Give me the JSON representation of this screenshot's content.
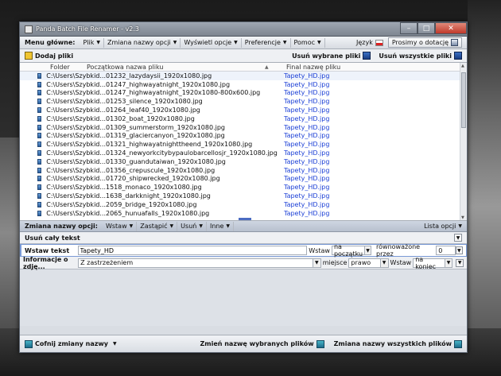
{
  "window": {
    "title": "Panda Batch File Renamer - v2.3"
  },
  "menubar": {
    "label": "Menu główne:",
    "items": [
      "Plik",
      "Zmiana nazwy opcji",
      "Wyświetl opcje",
      "Preferencje",
      "Pomoc"
    ],
    "language": "Język",
    "donate": "Prosimy o dotację"
  },
  "toolbar": {
    "add_files": "Dodaj pliki",
    "remove_selected": "Usuń wybrane pliki",
    "remove_all": "Usuń wszystkie pliki"
  },
  "filelist": {
    "headers": {
      "folder": "Folder",
      "original": "Początkowa nazwa pliku",
      "final": "Final nazwę pliku"
    },
    "rows": [
      {
        "folder": "C:\\Users\\Szybkid...",
        "original": "01232_lazydaysii_1920x1080.jpg",
        "final": "Tapety_HD.jpg"
      },
      {
        "folder": "C:\\Users\\Szybkid...",
        "original": "01247_highwayatnight_1920x1080.jpg",
        "final": "Tapety_HD.jpg"
      },
      {
        "folder": "C:\\Users\\Szybkid...",
        "original": "01247_highwayatnight_1920x1080-800x600.jpg",
        "final": "Tapety_HD.jpg"
      },
      {
        "folder": "C:\\Users\\Szybkid...",
        "original": "01253_silence_1920x1080.jpg",
        "final": "Tapety_HD.jpg"
      },
      {
        "folder": "C:\\Users\\Szybkid...",
        "original": "01264_leaf40_1920x1080.jpg",
        "final": "Tapety_HD.jpg"
      },
      {
        "folder": "C:\\Users\\Szybkid...",
        "original": "01302_boat_1920x1080.jpg",
        "final": "Tapety_HD.jpg"
      },
      {
        "folder": "C:\\Users\\Szybkid...",
        "original": "01309_summerstorm_1920x1080.jpg",
        "final": "Tapety_HD.jpg"
      },
      {
        "folder": "C:\\Users\\Szybkid...",
        "original": "01319_glaciercanyon_1920x1080.jpg",
        "final": "Tapety_HD.jpg"
      },
      {
        "folder": "C:\\Users\\Szybkid...",
        "original": "01321_highwayatnighttheend_1920x1080.jpg",
        "final": "Tapety_HD.jpg"
      },
      {
        "folder": "C:\\Users\\Szybkid...",
        "original": "01324_newyorkcitybypaulobarcellosjr_1920x1080.jpg",
        "final": "Tapety_HD.jpg"
      },
      {
        "folder": "C:\\Users\\Szybkid...",
        "original": "01330_guandutaiwan_1920x1080.jpg",
        "final": "Tapety_HD.jpg"
      },
      {
        "folder": "C:\\Users\\Szybkid...",
        "original": "01356_crepuscule_1920x1080.jpg",
        "final": "Tapety_HD.jpg"
      },
      {
        "folder": "C:\\Users\\Szybkid...",
        "original": "01720_shipwrecked_1920x1080.jpg",
        "final": "Tapety_HD.jpg"
      },
      {
        "folder": "C:\\Users\\Szybkid...",
        "original": "1518_monaco_1920x1080.jpg",
        "final": "Tapety_HD.jpg"
      },
      {
        "folder": "C:\\Users\\Szybkid...",
        "original": "1638_darkknight_1920x1080.jpg",
        "final": "Tapety_HD.jpg"
      },
      {
        "folder": "C:\\Users\\Szybkid...",
        "original": "2059_bridge_1920x1080.jpg",
        "final": "Tapety_HD.jpg"
      },
      {
        "folder": "C:\\Users\\Szybkid...",
        "original": "2065_hunuafalls_1920x1080.jpg",
        "final": "Tapety_HD.jpg"
      }
    ]
  },
  "rename_bar": {
    "label": "Zmiana nazwy opcji:",
    "items": [
      "Wstaw",
      "Zastąpić",
      "Usuń",
      "Inne"
    ],
    "list_options": "Lista opcji"
  },
  "remove_all_text": "Usuń cały tekst",
  "insert_text": {
    "label": "Wstaw tekst",
    "value": "Tapety_HD",
    "insert_label": "Wstaw",
    "position": "na początku",
    "equal_label": "równoważone przez",
    "offset": "0"
  },
  "photo_info": {
    "label": "Informacje o zdję...",
    "value": "Z zastrzeżeniem",
    "place_label": "miejsce",
    "place": "prawo",
    "insert_label": "Wstaw",
    "insert_position": "na koniec"
  },
  "bottombar": {
    "undo": "Cofnij zmiany nazwy",
    "rename_selected": "Zmień nazwę wybranych plików",
    "rename_all": "Zmiana nazwy wszystkich plików"
  }
}
